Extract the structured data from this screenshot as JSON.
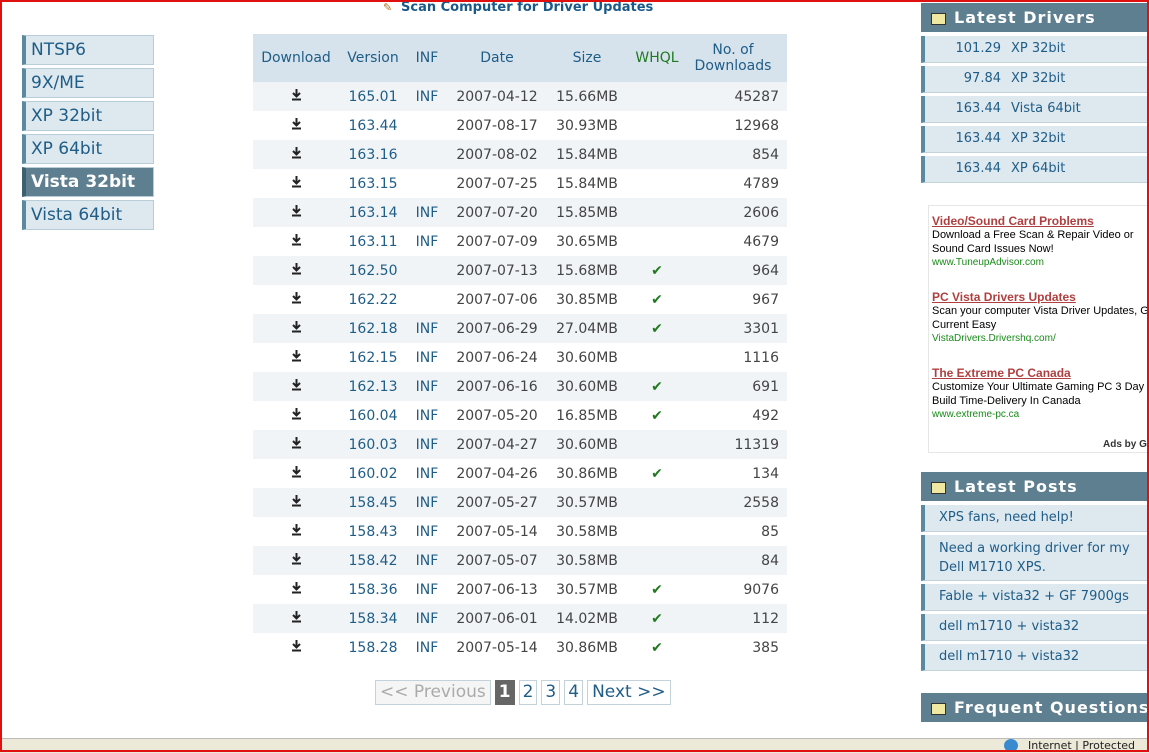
{
  "top_link": {
    "icon": "pencil-icon",
    "label": "Scan Computer for Driver Updates"
  },
  "left_nav": [
    {
      "label": "NTSP6",
      "active": false
    },
    {
      "label": "9X/ME",
      "active": false
    },
    {
      "label": "XP 32bit",
      "active": false
    },
    {
      "label": "XP 64bit",
      "active": false
    },
    {
      "label": "Vista 32bit",
      "active": true
    },
    {
      "label": "Vista 64bit",
      "active": false
    }
  ],
  "table": {
    "headers": {
      "download": "Download",
      "version": "Version",
      "inf": "INF",
      "date": "Date",
      "size": "Size",
      "whql": "WHQL",
      "downloads_l1": "No. of",
      "downloads_l2": "Downloads"
    },
    "download_icon": "download-arrow-icon",
    "whql_mark": "✔",
    "rows": [
      {
        "version": "165.01",
        "inf": "INF",
        "date": "2007-04-12",
        "size": "15.66MB",
        "whql": false,
        "downloads": "45287"
      },
      {
        "version": "163.44",
        "inf": "",
        "date": "2007-08-17",
        "size": "30.93MB",
        "whql": false,
        "downloads": "12968"
      },
      {
        "version": "163.16",
        "inf": "",
        "date": "2007-08-02",
        "size": "15.84MB",
        "whql": false,
        "downloads": "854"
      },
      {
        "version": "163.15",
        "inf": "",
        "date": "2007-07-25",
        "size": "15.84MB",
        "whql": false,
        "downloads": "4789"
      },
      {
        "version": "163.14",
        "inf": "INF",
        "date": "2007-07-20",
        "size": "15.85MB",
        "whql": false,
        "downloads": "2606"
      },
      {
        "version": "163.11",
        "inf": "INF",
        "date": "2007-07-09",
        "size": "30.65MB",
        "whql": false,
        "downloads": "4679"
      },
      {
        "version": "162.50",
        "inf": "",
        "date": "2007-07-13",
        "size": "15.68MB",
        "whql": true,
        "downloads": "964"
      },
      {
        "version": "162.22",
        "inf": "",
        "date": "2007-07-06",
        "size": "30.85MB",
        "whql": true,
        "downloads": "967"
      },
      {
        "version": "162.18",
        "inf": "INF",
        "date": "2007-06-29",
        "size": "27.04MB",
        "whql": true,
        "downloads": "3301"
      },
      {
        "version": "162.15",
        "inf": "INF",
        "date": "2007-06-24",
        "size": "30.60MB",
        "whql": false,
        "downloads": "1116"
      },
      {
        "version": "162.13",
        "inf": "INF",
        "date": "2007-06-16",
        "size": "30.60MB",
        "whql": true,
        "downloads": "691"
      },
      {
        "version": "160.04",
        "inf": "INF",
        "date": "2007-05-20",
        "size": "16.85MB",
        "whql": true,
        "downloads": "492"
      },
      {
        "version": "160.03",
        "inf": "INF",
        "date": "2007-04-27",
        "size": "30.60MB",
        "whql": false,
        "downloads": "11319"
      },
      {
        "version": "160.02",
        "inf": "INF",
        "date": "2007-04-26",
        "size": "30.86MB",
        "whql": true,
        "downloads": "134"
      },
      {
        "version": "158.45",
        "inf": "INF",
        "date": "2007-05-27",
        "size": "30.57MB",
        "whql": false,
        "downloads": "2558"
      },
      {
        "version": "158.43",
        "inf": "INF",
        "date": "2007-05-14",
        "size": "30.58MB",
        "whql": false,
        "downloads": "85"
      },
      {
        "version": "158.42",
        "inf": "INF",
        "date": "2007-05-07",
        "size": "30.58MB",
        "whql": false,
        "downloads": "84"
      },
      {
        "version": "158.36",
        "inf": "INF",
        "date": "2007-06-13",
        "size": "30.57MB",
        "whql": true,
        "downloads": "9076"
      },
      {
        "version": "158.34",
        "inf": "INF",
        "date": "2007-06-01",
        "size": "14.02MB",
        "whql": true,
        "downloads": "112"
      },
      {
        "version": "158.28",
        "inf": "INF",
        "date": "2007-05-14",
        "size": "30.86MB",
        "whql": true,
        "downloads": "385"
      }
    ]
  },
  "pagination": {
    "prev": "<< Previous",
    "pages": [
      "1",
      "2",
      "3",
      "4"
    ],
    "current": "1",
    "next": "Next >>"
  },
  "latest_drivers": {
    "title": "Latest Drivers",
    "icon": "drivers-icon",
    "items": [
      {
        "version": "101.29",
        "os": "XP 32bit"
      },
      {
        "version": "97.84",
        "os": "XP 32bit"
      },
      {
        "version": "163.44",
        "os": "Vista 64bit"
      },
      {
        "version": "163.44",
        "os": "XP 32bit"
      },
      {
        "version": "163.44",
        "os": "XP 64bit"
      }
    ]
  },
  "ads": {
    "items": [
      {
        "title": "Video/Sound Card Problems",
        "text": "Download a Free Scan & Repair Video or Sound Card Issues Now!",
        "url": "www.TuneupAdvisor.com"
      },
      {
        "title": "PC Vista Drivers Updates",
        "text": "Scan your computer Vista Driver Updates, Get Current Easy",
        "url": "VistaDrivers.Drivershq.com/"
      },
      {
        "title": "The Extreme PC Canada",
        "text": "Customize Your Ultimate Gaming PC 3 Day Build Time-Delivery In Canada",
        "url": "www.extreme-pc.ca"
      }
    ],
    "ads_by": "Ads by Go"
  },
  "latest_posts": {
    "title": "Latest Posts",
    "icon": "posts-icon",
    "items": [
      {
        "text": "XPS fans, need help!"
      },
      {
        "text": "Need a working driver for my Dell M1710 XPS."
      },
      {
        "text": "Fable + vista32 + GF 7900gs"
      },
      {
        "text": "dell m1710 + vista32"
      },
      {
        "text": "dell m1710 + vista32"
      }
    ]
  },
  "faq": {
    "title": "Frequent Questions",
    "icon": "faq-icon"
  },
  "status_bar": {
    "text": "Internet | Protected"
  }
}
